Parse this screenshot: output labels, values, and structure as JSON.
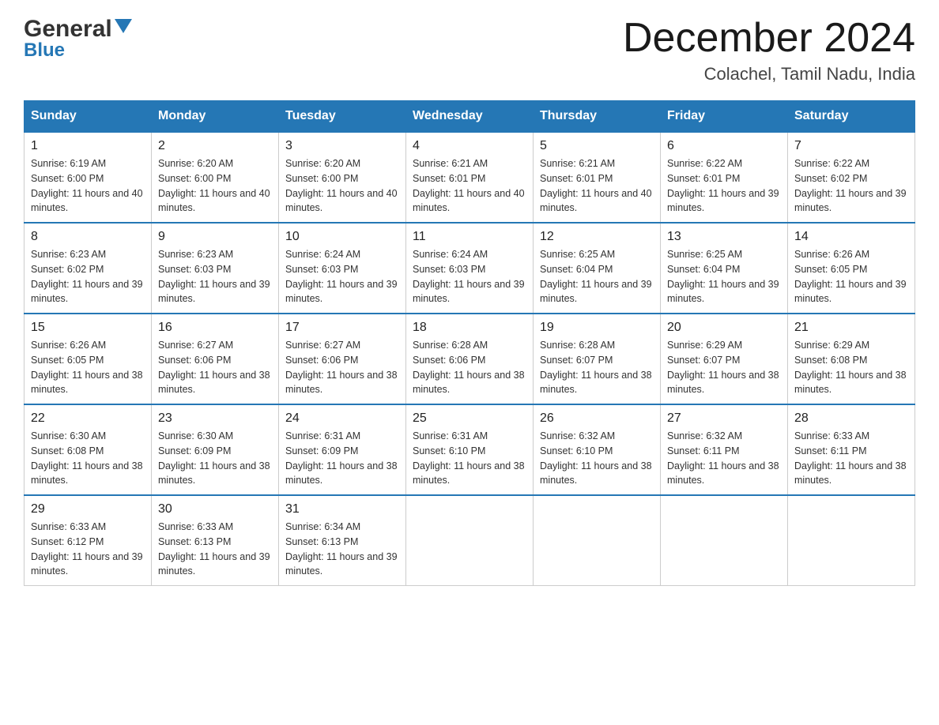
{
  "header": {
    "logo_general": "General",
    "logo_blue": "Blue",
    "month_title": "December 2024",
    "location": "Colachel, Tamil Nadu, India"
  },
  "weekdays": [
    "Sunday",
    "Monday",
    "Tuesday",
    "Wednesday",
    "Thursday",
    "Friday",
    "Saturday"
  ],
  "weeks": [
    [
      {
        "day": "1",
        "sunrise": "6:19 AM",
        "sunset": "6:00 PM",
        "daylight": "11 hours and 40 minutes."
      },
      {
        "day": "2",
        "sunrise": "6:20 AM",
        "sunset": "6:00 PM",
        "daylight": "11 hours and 40 minutes."
      },
      {
        "day": "3",
        "sunrise": "6:20 AM",
        "sunset": "6:00 PM",
        "daylight": "11 hours and 40 minutes."
      },
      {
        "day": "4",
        "sunrise": "6:21 AM",
        "sunset": "6:01 PM",
        "daylight": "11 hours and 40 minutes."
      },
      {
        "day": "5",
        "sunrise": "6:21 AM",
        "sunset": "6:01 PM",
        "daylight": "11 hours and 40 minutes."
      },
      {
        "day": "6",
        "sunrise": "6:22 AM",
        "sunset": "6:01 PM",
        "daylight": "11 hours and 39 minutes."
      },
      {
        "day": "7",
        "sunrise": "6:22 AM",
        "sunset": "6:02 PM",
        "daylight": "11 hours and 39 minutes."
      }
    ],
    [
      {
        "day": "8",
        "sunrise": "6:23 AM",
        "sunset": "6:02 PM",
        "daylight": "11 hours and 39 minutes."
      },
      {
        "day": "9",
        "sunrise": "6:23 AM",
        "sunset": "6:03 PM",
        "daylight": "11 hours and 39 minutes."
      },
      {
        "day": "10",
        "sunrise": "6:24 AM",
        "sunset": "6:03 PM",
        "daylight": "11 hours and 39 minutes."
      },
      {
        "day": "11",
        "sunrise": "6:24 AM",
        "sunset": "6:03 PM",
        "daylight": "11 hours and 39 minutes."
      },
      {
        "day": "12",
        "sunrise": "6:25 AM",
        "sunset": "6:04 PM",
        "daylight": "11 hours and 39 minutes."
      },
      {
        "day": "13",
        "sunrise": "6:25 AM",
        "sunset": "6:04 PM",
        "daylight": "11 hours and 39 minutes."
      },
      {
        "day": "14",
        "sunrise": "6:26 AM",
        "sunset": "6:05 PM",
        "daylight": "11 hours and 39 minutes."
      }
    ],
    [
      {
        "day": "15",
        "sunrise": "6:26 AM",
        "sunset": "6:05 PM",
        "daylight": "11 hours and 38 minutes."
      },
      {
        "day": "16",
        "sunrise": "6:27 AM",
        "sunset": "6:06 PM",
        "daylight": "11 hours and 38 minutes."
      },
      {
        "day": "17",
        "sunrise": "6:27 AM",
        "sunset": "6:06 PM",
        "daylight": "11 hours and 38 minutes."
      },
      {
        "day": "18",
        "sunrise": "6:28 AM",
        "sunset": "6:06 PM",
        "daylight": "11 hours and 38 minutes."
      },
      {
        "day": "19",
        "sunrise": "6:28 AM",
        "sunset": "6:07 PM",
        "daylight": "11 hours and 38 minutes."
      },
      {
        "day": "20",
        "sunrise": "6:29 AM",
        "sunset": "6:07 PM",
        "daylight": "11 hours and 38 minutes."
      },
      {
        "day": "21",
        "sunrise": "6:29 AM",
        "sunset": "6:08 PM",
        "daylight": "11 hours and 38 minutes."
      }
    ],
    [
      {
        "day": "22",
        "sunrise": "6:30 AM",
        "sunset": "6:08 PM",
        "daylight": "11 hours and 38 minutes."
      },
      {
        "day": "23",
        "sunrise": "6:30 AM",
        "sunset": "6:09 PM",
        "daylight": "11 hours and 38 minutes."
      },
      {
        "day": "24",
        "sunrise": "6:31 AM",
        "sunset": "6:09 PM",
        "daylight": "11 hours and 38 minutes."
      },
      {
        "day": "25",
        "sunrise": "6:31 AM",
        "sunset": "6:10 PM",
        "daylight": "11 hours and 38 minutes."
      },
      {
        "day": "26",
        "sunrise": "6:32 AM",
        "sunset": "6:10 PM",
        "daylight": "11 hours and 38 minutes."
      },
      {
        "day": "27",
        "sunrise": "6:32 AM",
        "sunset": "6:11 PM",
        "daylight": "11 hours and 38 minutes."
      },
      {
        "day": "28",
        "sunrise": "6:33 AM",
        "sunset": "6:11 PM",
        "daylight": "11 hours and 38 minutes."
      }
    ],
    [
      {
        "day": "29",
        "sunrise": "6:33 AM",
        "sunset": "6:12 PM",
        "daylight": "11 hours and 39 minutes."
      },
      {
        "day": "30",
        "sunrise": "6:33 AM",
        "sunset": "6:13 PM",
        "daylight": "11 hours and 39 minutes."
      },
      {
        "day": "31",
        "sunrise": "6:34 AM",
        "sunset": "6:13 PM",
        "daylight": "11 hours and 39 minutes."
      },
      null,
      null,
      null,
      null
    ]
  ]
}
